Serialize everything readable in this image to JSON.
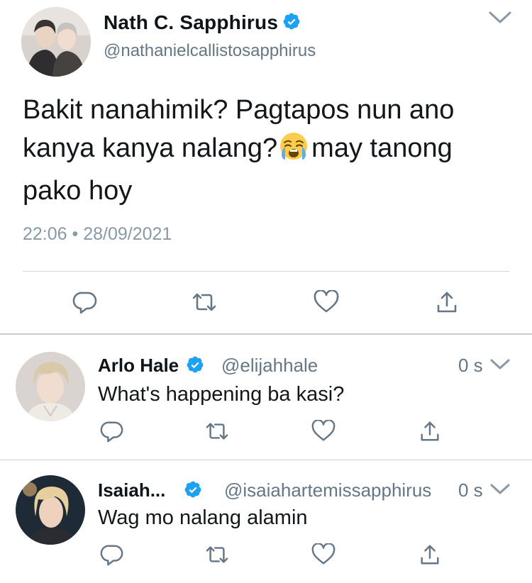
{
  "main_tweet": {
    "author_name": "Nath C. Sapphirus",
    "author_handle": "@nathanielcallistosapphirus",
    "text_before_emoji": "Bakit nanahimik? Pagtapos nun ano kanya kanya nalang?",
    "emoji": "loudly-crying-face",
    "text_after_emoji": "may tanong pako hoy",
    "timestamp": "22:06 • 28/09/2021"
  },
  "replies": [
    {
      "author_name": "Arlo Hale",
      "author_handle": "@elijahhale",
      "time": "0 s",
      "text": "What's happening ba kasi?"
    },
    {
      "author_name": "Isaiah...",
      "author_handle": "@isaiahartemissapphirus",
      "time": "0 s",
      "text": "Wag mo nalang alamin"
    }
  ],
  "icons": {
    "verified": "verified-badge-icon",
    "caret": "chevron-down-icon",
    "reply": "reply-icon",
    "retweet": "retweet-icon",
    "like": "heart-icon",
    "share": "share-icon"
  },
  "colors": {
    "verified_blue": "#1da1f2",
    "icon_gray": "#657786",
    "text": "#14171a",
    "meta_gray": "#8899a6"
  }
}
